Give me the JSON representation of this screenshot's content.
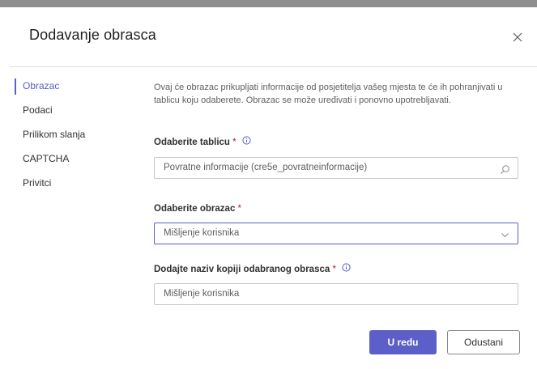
{
  "dialog": {
    "title": "Dodavanje obrasca",
    "close_icon": "close-icon"
  },
  "nav": {
    "items": [
      {
        "label": "Obrazac",
        "active": true
      },
      {
        "label": "Podaci",
        "active": false
      },
      {
        "label": "Prilikom slanja",
        "active": false
      },
      {
        "label": "CAPTCHA",
        "active": false
      },
      {
        "label": "Privitci",
        "active": false
      }
    ]
  },
  "form": {
    "description": "Ovaj će obrazac prikupljati informacije od posjetitelja vašeg mjesta te će ih pohranjivati u tablicu koju odaberete. Obrazac se može uređivati i ponovno upotrebljavati.",
    "table_field": {
      "label": "Odaberite tablicu",
      "required_mark": "*",
      "value": "Povratne informacije (cre5e_povratneinformacije)",
      "icon": "search-icon"
    },
    "form_field": {
      "label": "Odaberite obrazac",
      "required_mark": "*",
      "value": "Mišljenje korisnika",
      "icon": "chevron-down-icon"
    },
    "name_field": {
      "label": "Dodajte naziv kopiji odabranog obrasca",
      "required_mark": "*",
      "value": "Mišljenje korisnika"
    }
  },
  "buttons": {
    "ok_label": "U redu",
    "cancel_label": "Odustani"
  },
  "colors": {
    "accent": "#5b5fc7",
    "required": "#a4262c"
  }
}
